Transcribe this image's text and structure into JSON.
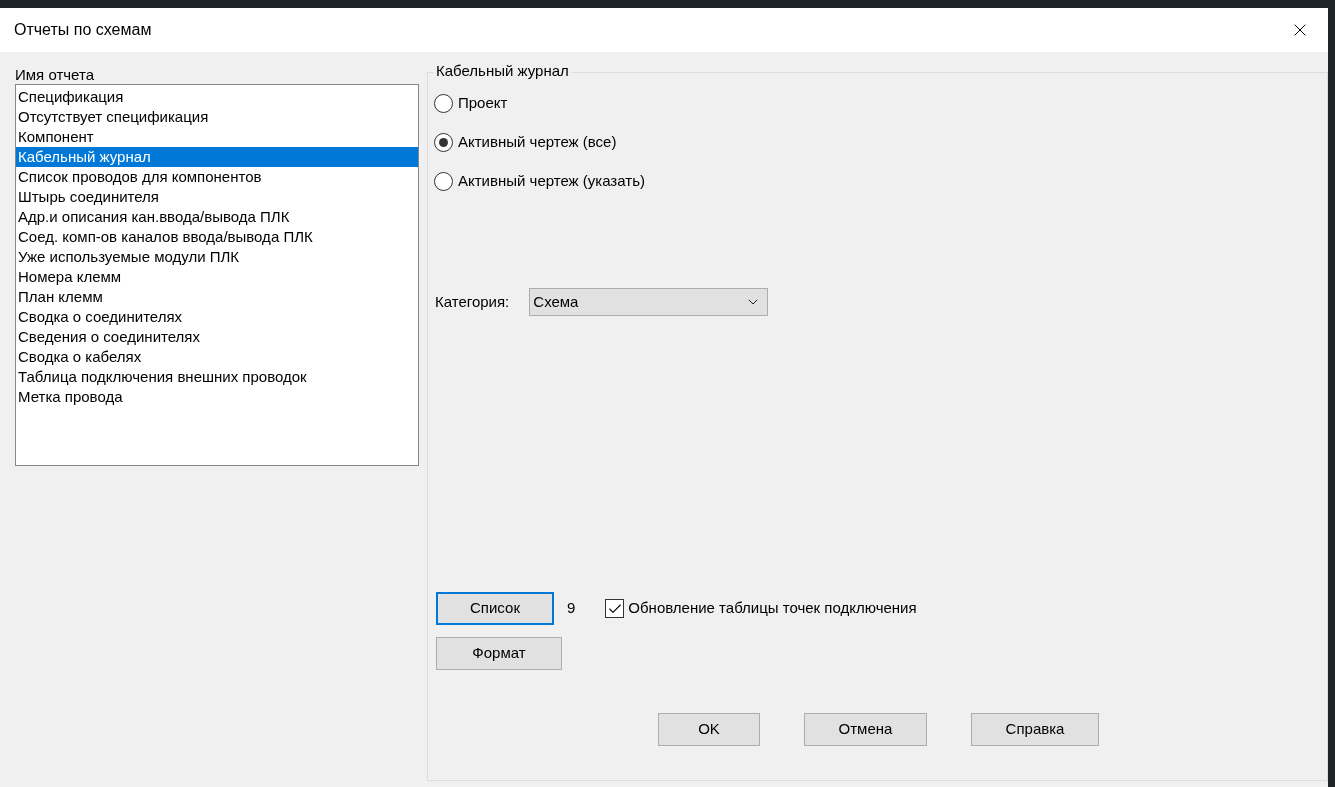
{
  "window": {
    "title": "Отчеты по схемам"
  },
  "report_list": {
    "label": "Имя отчета",
    "items": [
      {
        "label": "Спецификация",
        "selected": false
      },
      {
        "label": "Отсутствует спецификация",
        "selected": false
      },
      {
        "label": "Компонент",
        "selected": false
      },
      {
        "label": "Кабельный журнал",
        "selected": true
      },
      {
        "label": "Список проводов для компонентов",
        "selected": false
      },
      {
        "label": "Штырь соединителя",
        "selected": false
      },
      {
        "label": "Адр.и описания кан.ввода/вывода ПЛК",
        "selected": false
      },
      {
        "label": "Соед. комп-ов каналов ввода/вывода ПЛК",
        "selected": false
      },
      {
        "label": "Уже используемые модули ПЛК",
        "selected": false
      },
      {
        "label": "Номера клемм",
        "selected": false
      },
      {
        "label": "План клемм",
        "selected": false
      },
      {
        "label": "Сводка о соединителях",
        "selected": false
      },
      {
        "label": "Сведения о соединителях",
        "selected": false
      },
      {
        "label": "Сводка о кабелях",
        "selected": false
      },
      {
        "label": "Таблица подключения внешних проводок",
        "selected": false
      },
      {
        "label": "Метка провода",
        "selected": false
      }
    ]
  },
  "options": {
    "title": "Кабельный журнал",
    "scope": [
      {
        "label": "Проект",
        "selected": false
      },
      {
        "label": "Активный чертеж (все)",
        "selected": true
      },
      {
        "label": "Активный чертеж (указать)",
        "selected": false
      }
    ],
    "category": {
      "label": "Категория:",
      "value": "Схема"
    },
    "list_button": {
      "label": "Список",
      "focused": true
    },
    "count": "9",
    "update_checkbox": {
      "label": "Обновление таблицы точек подключения",
      "checked": true
    },
    "format_button": {
      "label": "Формат"
    }
  },
  "buttons": [
    "OK",
    "Отмена",
    "Справка"
  ]
}
